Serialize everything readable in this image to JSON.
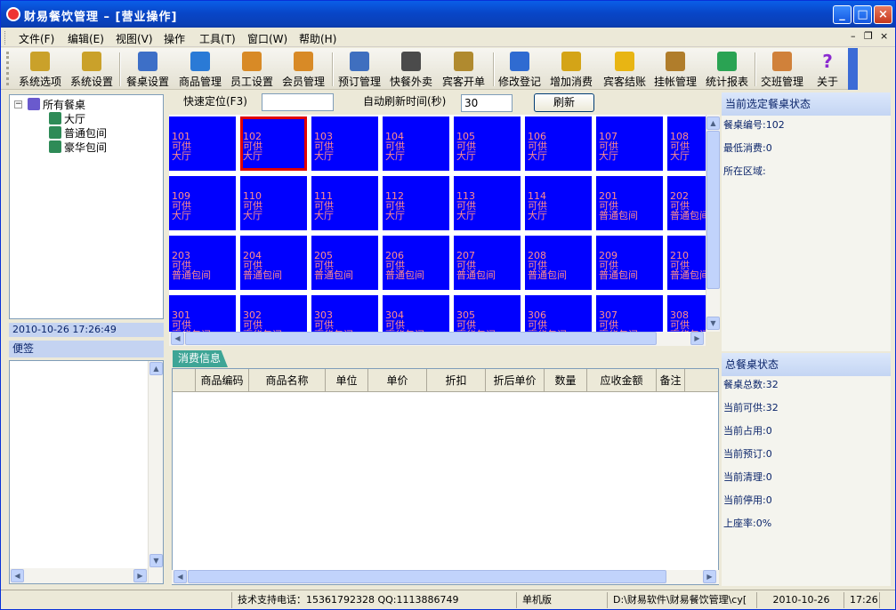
{
  "window": {
    "title": "财易餐饮管理 – [营业操作]"
  },
  "menu": [
    "文件(F)",
    "编辑(E)",
    "视图(V)",
    "操作",
    "工具(T)",
    "窗口(W)",
    "帮助(H)"
  ],
  "mdi_controls": [
    "–",
    "❐",
    "×"
  ],
  "toolbar": [
    {
      "label": "系统选项",
      "icon": "keys-icon",
      "color": "#caa12a"
    },
    {
      "label": "系统设置",
      "icon": "keys-icon",
      "color": "#caa12a"
    },
    {
      "label": "餐桌设置",
      "icon": "table-icon",
      "color": "#3d6fc7"
    },
    {
      "label": "商品管理",
      "icon": "box-icon",
      "color": "#2a7ad6"
    },
    {
      "label": "员工设置",
      "icon": "person-icon",
      "color": "#d88a26"
    },
    {
      "label": "会员管理",
      "icon": "person-icon",
      "color": "#d88a26"
    },
    {
      "label": "预订管理",
      "icon": "stamp-icon",
      "color": "#3f6fbf"
    },
    {
      "label": "快餐外卖",
      "icon": "phone-icon",
      "color": "#4b4b4b"
    },
    {
      "label": "宾客开单",
      "icon": "package-icon",
      "color": "#b08a2f"
    },
    {
      "label": "修改登记",
      "icon": "edit-person-icon",
      "color": "#2f6bd1"
    },
    {
      "label": "增加消费",
      "icon": "add-icon",
      "color": "#d4a417"
    },
    {
      "label": "宾客结账",
      "icon": "coin-icon",
      "color": "#e8b513"
    },
    {
      "label": "挂帐管理",
      "icon": "money-bag-icon",
      "color": "#b07d2b"
    },
    {
      "label": "统计报表",
      "icon": "chart-icon",
      "color": "#2aa353"
    },
    {
      "label": "交班管理",
      "icon": "people-icon",
      "color": "#d0813a"
    },
    {
      "label": "关于",
      "icon": "question-icon",
      "color": "#8b2bd0"
    }
  ],
  "tree": {
    "root": "所有餐桌",
    "children": [
      "大厅",
      "普通包间",
      "豪华包间"
    ]
  },
  "datetime": "2010-10-26  17:26:49",
  "notes_header": "便签",
  "quick_locate_label": "快速定位(F3)",
  "quick_locate_value": "",
  "auto_refresh_label": "自动刷新时间(秒)",
  "auto_refresh_value": "30",
  "refresh_button": "刷新",
  "tables": [
    {
      "no": "101",
      "status": "可供",
      "area": "大厅"
    },
    {
      "no": "102",
      "status": "可供",
      "area": "大厅",
      "selected": true
    },
    {
      "no": "103",
      "status": "可供",
      "area": "大厅"
    },
    {
      "no": "104",
      "status": "可供",
      "area": "大厅"
    },
    {
      "no": "105",
      "status": "可供",
      "area": "大厅"
    },
    {
      "no": "106",
      "status": "可供",
      "area": "大厅"
    },
    {
      "no": "107",
      "status": "可供",
      "area": "大厅"
    },
    {
      "no": "108",
      "status": "可供",
      "area": "大厅"
    },
    {
      "no": "109",
      "status": "可供",
      "area": "大厅"
    },
    {
      "no": "110",
      "status": "可供",
      "area": "大厅"
    },
    {
      "no": "111",
      "status": "可供",
      "area": "大厅"
    },
    {
      "no": "112",
      "status": "可供",
      "area": "大厅"
    },
    {
      "no": "113",
      "status": "可供",
      "area": "大厅"
    },
    {
      "no": "114",
      "status": "可供",
      "area": "大厅"
    },
    {
      "no": "201",
      "status": "可供",
      "area": "普通包间"
    },
    {
      "no": "202",
      "status": "可供",
      "area": "普通包间"
    },
    {
      "no": "203",
      "status": "可供",
      "area": "普通包间"
    },
    {
      "no": "204",
      "status": "可供",
      "area": "普通包间"
    },
    {
      "no": "205",
      "status": "可供",
      "area": "普通包间"
    },
    {
      "no": "206",
      "status": "可供",
      "area": "普通包间"
    },
    {
      "no": "207",
      "status": "可供",
      "area": "普通包间"
    },
    {
      "no": "208",
      "status": "可供",
      "area": "普通包间"
    },
    {
      "no": "209",
      "status": "可供",
      "area": "普通包间"
    },
    {
      "no": "210",
      "status": "可供",
      "area": "普通包间"
    },
    {
      "no": "301",
      "status": "可供",
      "area": "豪华包间"
    },
    {
      "no": "302",
      "status": "可供",
      "area": "豪华包间"
    },
    {
      "no": "303",
      "status": "可供",
      "area": "豪华包间"
    },
    {
      "no": "304",
      "status": "可供",
      "area": "豪华包间"
    },
    {
      "no": "305",
      "status": "可供",
      "area": "豪华包间"
    },
    {
      "no": "306",
      "status": "可供",
      "area": "豪华包间"
    },
    {
      "no": "307",
      "status": "可供",
      "area": "豪华包间"
    },
    {
      "no": "308",
      "status": "可供",
      "area": "豪华包间"
    }
  ],
  "consume_tab": "消费信息",
  "consume_columns": [
    "商品编码",
    "商品名称",
    "单位",
    "单价",
    "折扣",
    "折后单价",
    "数量",
    "应收金额",
    "备注"
  ],
  "selected_panel": {
    "title": "当前选定餐桌状态",
    "lines": [
      "餐桌编号:102",
      "最低消费:0",
      "所在区域:"
    ]
  },
  "summary_panel": {
    "title": "总餐桌状态",
    "lines": [
      "餐桌总数:32",
      "当前可供:32",
      "当前占用:0",
      "当前预订:0",
      "当前清理:0",
      "当前停用:0",
      "上座率:0%"
    ]
  },
  "status": {
    "support": "技术支持电话：15361792328 QQ:1113886749",
    "edition": "单机版",
    "path": "D:\\财易软件\\财易餐饮管理\\cy[",
    "date": "2010-10-26",
    "time": "17:26"
  },
  "colors": {
    "tile_bg": "#0000ff",
    "tile_text": "#ff8c8c",
    "selected_border": "#e00000",
    "tab_bg": "#3ea596"
  }
}
